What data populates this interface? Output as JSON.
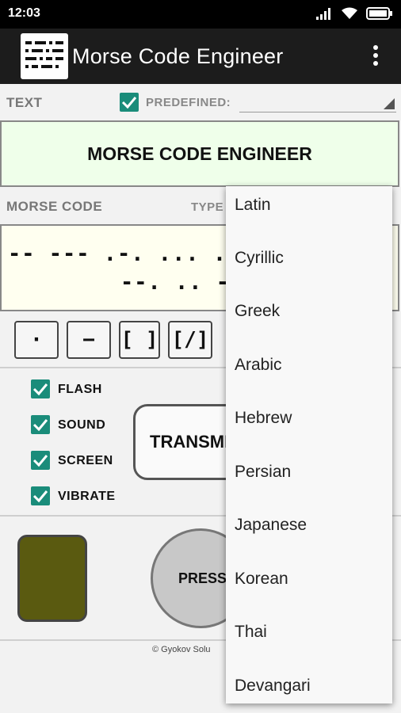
{
  "status_bar": {
    "time": "12:03"
  },
  "app_bar": {
    "title": "Morse Code Engineer"
  },
  "text_section": {
    "label": "TEXT",
    "predefined_label": "PREDEFINED:",
    "predefined_checked": true,
    "input_text": "MORSE CODE ENGINEER"
  },
  "morse_section": {
    "label": "MORSE CODE",
    "type_label": "TYPE",
    "line1": "-- --- .-. ... . / -.-",
    "line2": "--. .. -. ."
  },
  "keys": {
    "dot": "·",
    "dash": "−",
    "bracket": "[ ]",
    "slash_bracket": "[/]"
  },
  "options": [
    {
      "label": "FLASH",
      "checked": true
    },
    {
      "label": "SOUND",
      "checked": true
    },
    {
      "label": "SCREEN",
      "checked": true
    },
    {
      "label": "VIBRATE",
      "checked": true
    }
  ],
  "transmit_label": "TRANSMIT",
  "press_label": "PRESS",
  "footer": "© Gyokov Solu",
  "dropdown_items": [
    "Latin",
    "Cyrillic",
    "Greek",
    "Arabic",
    "Hebrew",
    "Persian",
    "Japanese",
    "Korean",
    "Thai",
    "Devangari"
  ],
  "colors": {
    "accent": "#1a8c7a",
    "text_box_bg": "#efffea",
    "morse_box_bg": "#fffff0",
    "signal_lamp": "#5a5a10"
  }
}
